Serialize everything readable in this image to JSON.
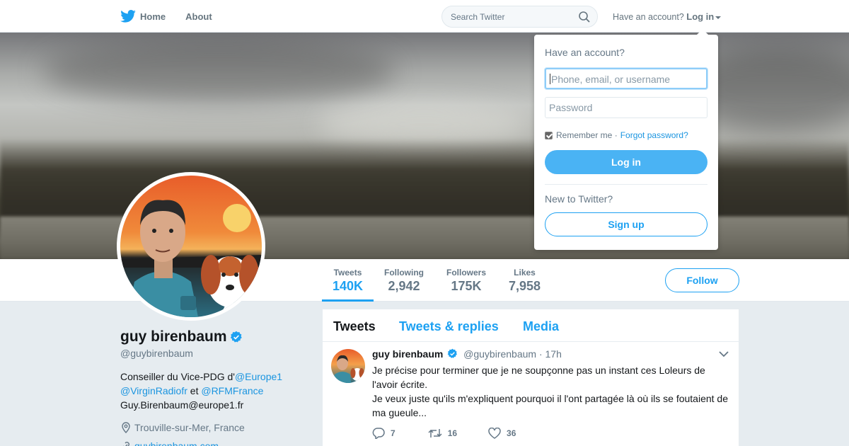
{
  "nav": {
    "home": "Home",
    "about": "About",
    "search_placeholder": "Search Twitter",
    "have_account": "Have an account?",
    "login": "Log in"
  },
  "login_dropdown": {
    "title": "Have an account?",
    "username_placeholder": "Phone, email, or username",
    "password_placeholder": "Password",
    "remember_me": "Remember me",
    "separator": "·",
    "forgot_password": "Forgot password?",
    "login_button": "Log in",
    "new_to_twitter": "New to Twitter?",
    "signup_button": "Sign up"
  },
  "stats": [
    {
      "label": "Tweets",
      "value": "140K"
    },
    {
      "label": "Following",
      "value": "2,942"
    },
    {
      "label": "Followers",
      "value": "175K"
    },
    {
      "label": "Likes",
      "value": "7,958"
    }
  ],
  "follow_button": "Follow",
  "profile": {
    "name": "guy birenbaum",
    "handle": "@guybirenbaum",
    "bio_prefix": "Conseiller du Vice-PDG d'",
    "bio_mention1": "@Europe1",
    "bio_mention2": "@VirginRadiofr",
    "bio_and": " et ",
    "bio_mention3": "@RFMFrance",
    "bio_email": "Guy.Birenbaum@europe1.fr",
    "location": "Trouville-sur-Mer, France",
    "url": "guybirenbaum.com"
  },
  "timeline_tabs": [
    "Tweets",
    "Tweets & replies",
    "Media"
  ],
  "tweet": {
    "name": "guy birenbaum",
    "handle": "@guybirenbaum",
    "time": "· 17h",
    "text1": "Je précise pour terminer que je ne soupçonne pas un instant ces Loleurs de l'avoir écrite.",
    "text2": "Je veux juste qu'ils m'expliquent pourquoi il l'ont partagée là où ils se foutaient de ma gueule...",
    "replies": "7",
    "retweets": "16",
    "likes": "36"
  },
  "colors": {
    "accent": "#1da1f2",
    "login_button": "#4ab3f4"
  }
}
